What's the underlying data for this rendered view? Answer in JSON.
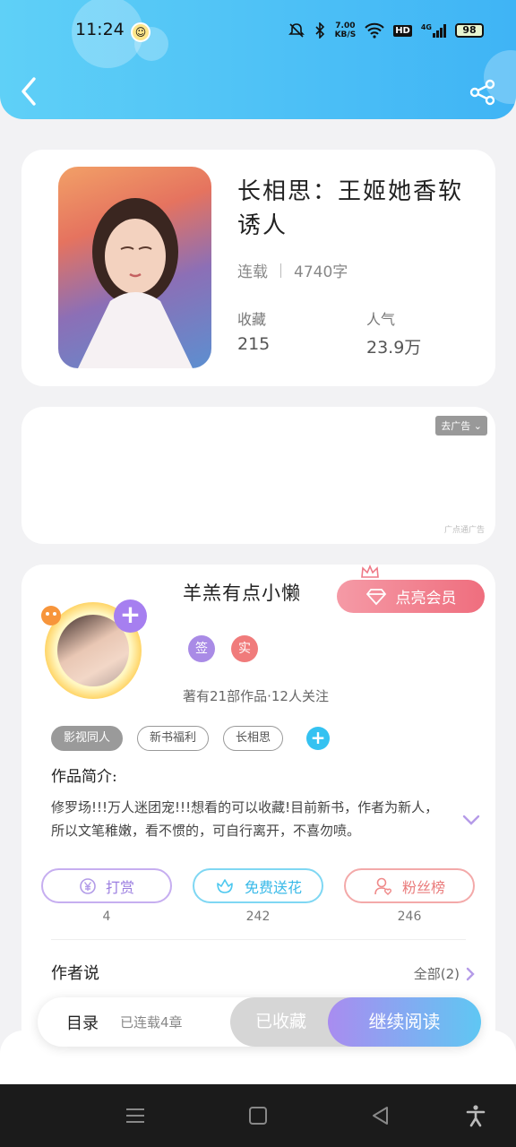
{
  "status_bar": {
    "time": "11:24",
    "net_speed_top": "7.00",
    "net_speed_bottom": "KB/S",
    "hd": "HD",
    "signal": "4G",
    "battery": "98"
  },
  "header": {
    "back_icon": "chevron-left-icon",
    "share_icon": "share-icon",
    "gradient": [
      "#5fd0f7",
      "#3fb4f5"
    ]
  },
  "book": {
    "title": "长相思：王姬她香软诱人",
    "status": "连载",
    "word_count": "4740字",
    "favorites_label": "收藏",
    "favorites_value": "215",
    "popularity_label": "人气",
    "popularity_value": "23.9万"
  },
  "ad": {
    "close_label": "去广告",
    "source_label": "广点通广告"
  },
  "author": {
    "name": "羊羔有点小懒",
    "vip_button": "点亮会员",
    "badge_signed": "签",
    "badge_verified": "实",
    "works_info": "著有21部作品·12人关注",
    "tags": [
      "影视同人",
      "新书福利",
      "长相思"
    ],
    "intro_title": "作品简介:",
    "intro_text": "修罗场!!!万人迷团宠!!!想看的可以收藏!目前新书，作者为新人，所以文笔稚嫩，看不惯的，可自行离开，不喜勿喷。",
    "actions": [
      {
        "label": "打赏",
        "count": "4",
        "color": "#b99ae6",
        "icon": "yen-coin-icon"
      },
      {
        "label": "免费送花",
        "count": "242",
        "color": "#4ec8ef",
        "icon": "flower-icon"
      },
      {
        "label": "粉丝榜",
        "count": "246",
        "color": "#ef8a8a",
        "icon": "fan-user-icon"
      }
    ],
    "author_say_title": "作者说",
    "all_link": "全部(2)"
  },
  "bottom_bar": {
    "toc_label": "目录",
    "toc_sub": "已连载4章",
    "collected": "已收藏",
    "continue_reading": "继续阅读"
  }
}
